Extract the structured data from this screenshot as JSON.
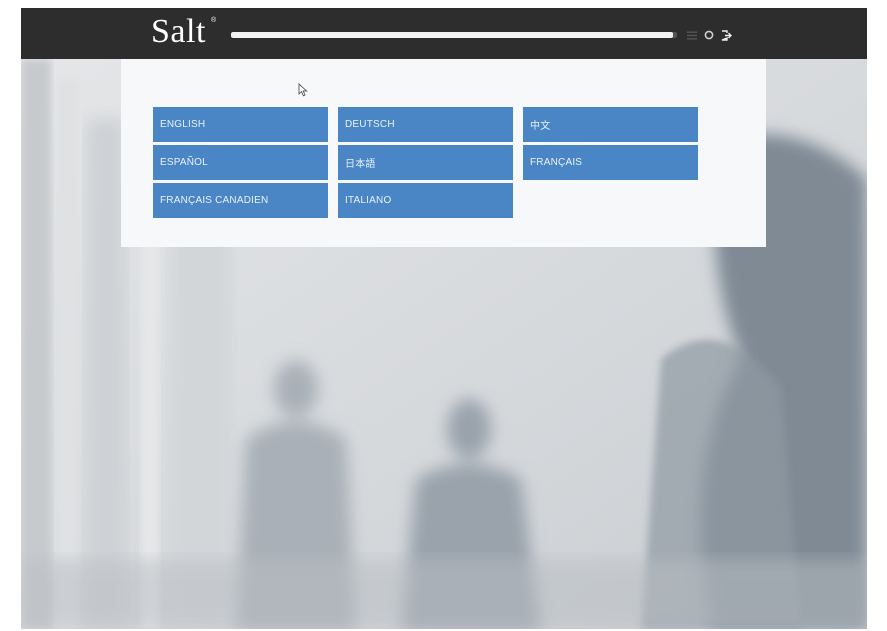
{
  "header": {
    "logo_text": "Salt",
    "logo_mark": "®",
    "progress_fraction": 0.99,
    "icons": [
      "menu-icon",
      "settings-icon",
      "logout-icon"
    ]
  },
  "language_menu": {
    "items": [
      {
        "label": "ENGLISH"
      },
      {
        "label": "DEUTSCH"
      },
      {
        "label": "中文"
      },
      {
        "label": "ESPAÑOL"
      },
      {
        "label": "日本語"
      },
      {
        "label": "FRANÇAIS"
      },
      {
        "label": "FRANÇAIS CANADIEN"
      },
      {
        "label": "ITALIANO"
      }
    ]
  },
  "colors": {
    "topbar": "#2d2d2d",
    "button": "#4a86c5",
    "panel": "#f7f8f9"
  }
}
